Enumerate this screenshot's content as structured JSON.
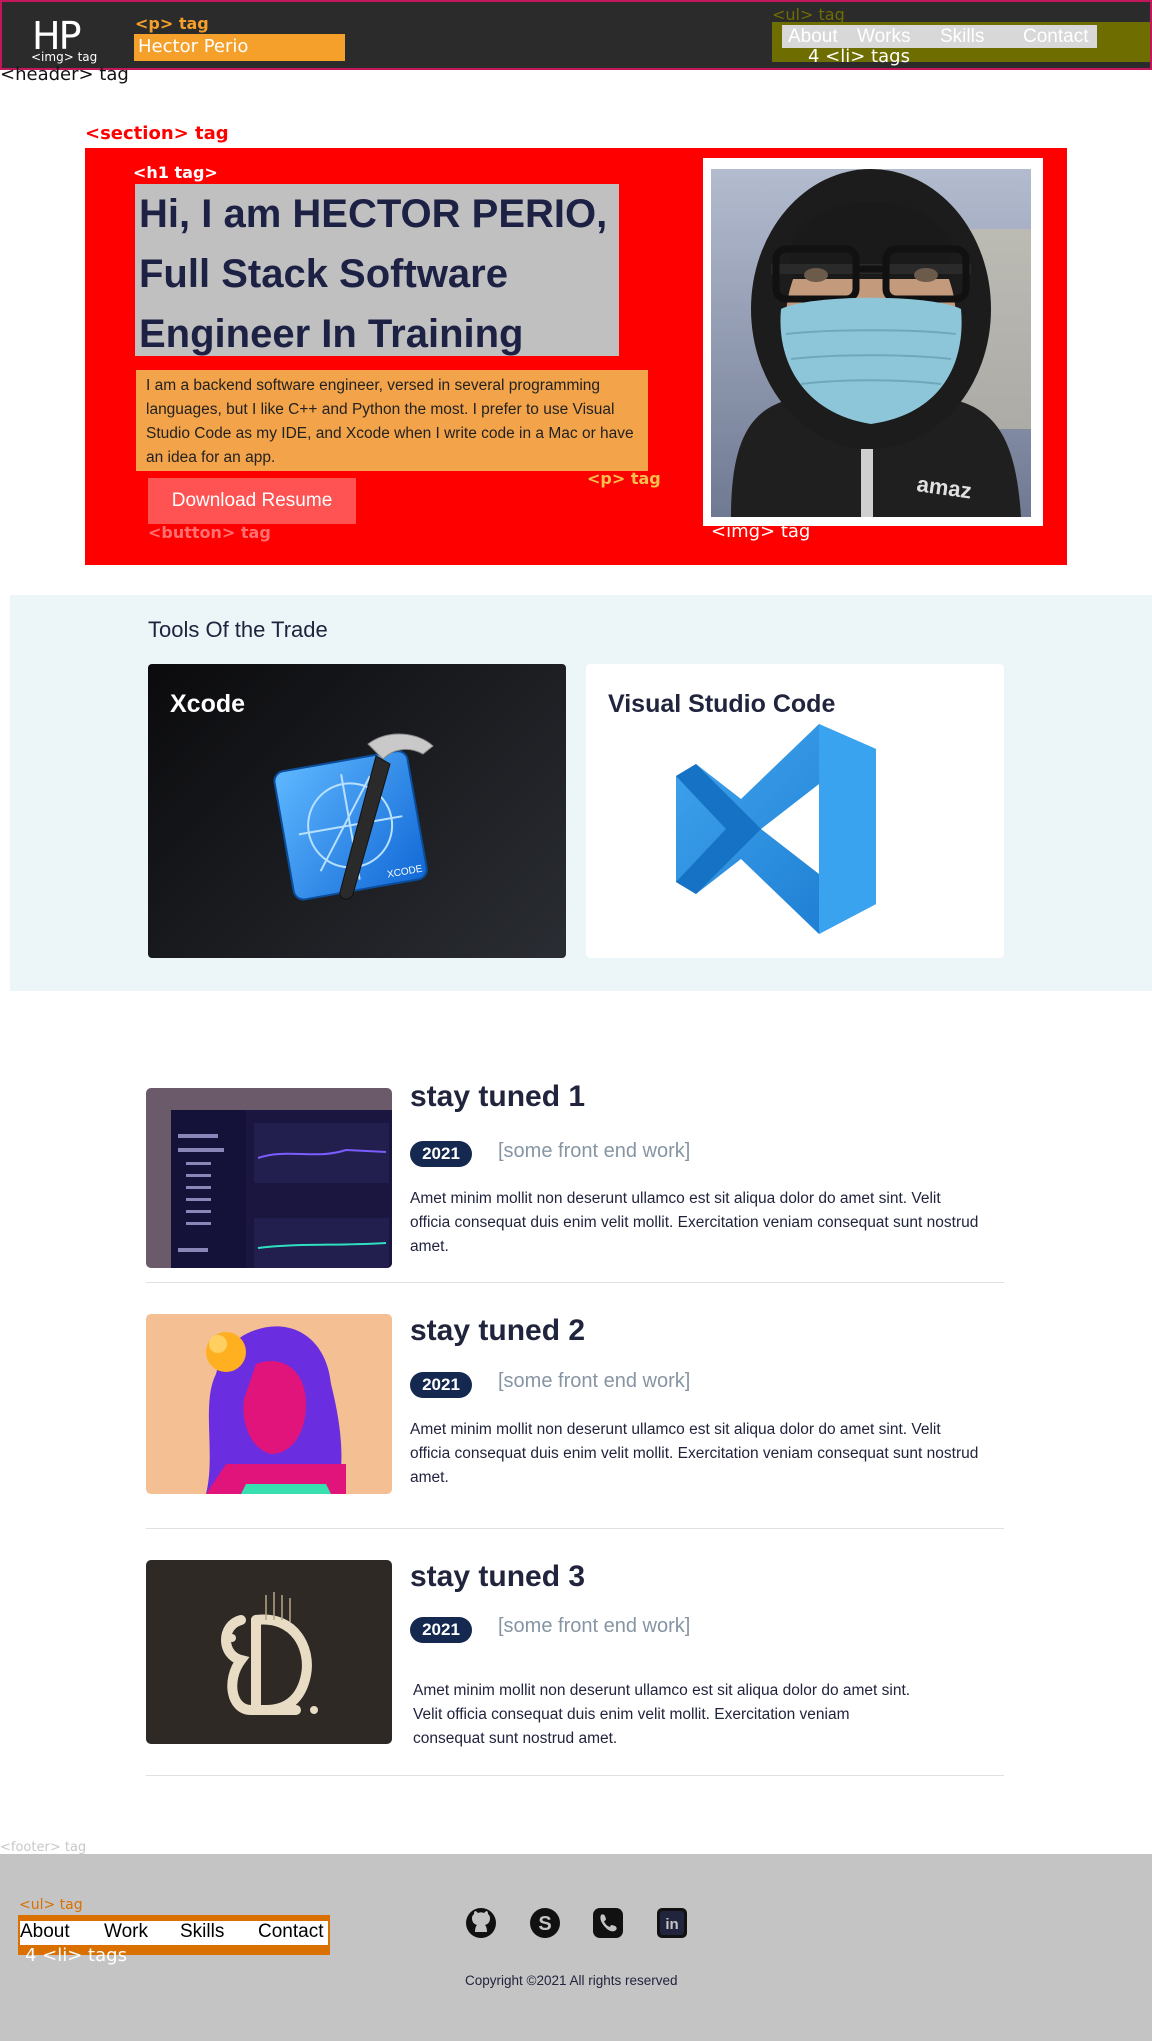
{
  "header": {
    "logo": "HP",
    "logo_tag": "<img> tag",
    "p_tag": "<p> tag",
    "brand": "Hector Perio",
    "ul_tag": "<ul> tag",
    "nav": [
      "About",
      "Works",
      "Skills",
      "Contact"
    ],
    "li_tags": "4 <li> tags",
    "header_tag": "<header> tag"
  },
  "hero": {
    "section_tag": "<section> tag",
    "h1_tag": "<h1 tag>",
    "h1_lines": [
      "Hi, I am HECTOR PERIO,",
      "Full Stack Software",
      "Engineer In Training"
    ],
    "intro": "I am a backend software engineer, versed in several programming languages, but I like C++ and Python the most. I prefer to use Visual Studio Code as my IDE, and Xcode when I write code in a Mac or have an idea for an app.",
    "p_tag": "<p> tag",
    "button": "Download Resume",
    "button_tag": "<button> tag",
    "img_tag": "<img> tag"
  },
  "tools": {
    "title": "Tools Of the Trade",
    "items": [
      {
        "name": "Xcode",
        "icon": "xcode-icon"
      },
      {
        "name": "Visual Studio Code",
        "icon": "vscode-icon"
      }
    ]
  },
  "works": [
    {
      "title": "stay tuned 1",
      "year": "2021",
      "category": "[some front end work]",
      "desc": "Amet minim mollit non deserunt ullamco est sit aliqua dolor do amet sint. Velit officia consequat duis enim velit mollit. Exercitation veniam consequat sunt nostrud amet."
    },
    {
      "title": "stay tuned 2",
      "year": "2021",
      "category": "[some front end work]",
      "desc": "Amet minim mollit non deserunt ullamco est sit aliqua dolor do amet sint. Velit officia consequat duis enim velit mollit. Exercitation veniam consequat sunt nostrud amet."
    },
    {
      "title": "stay tuned 3",
      "year": "2021",
      "category": "[some front end work]",
      "desc": "Amet minim mollit non deserunt ullamco est sit aliqua dolor do amet sint. Velit officia consequat duis enim velit mollit. Exercitation veniam consequat sunt nostrud amet."
    }
  ],
  "footer": {
    "footer_tag": "<footer> tag",
    "ul_tag": "<ul> tag",
    "nav": [
      "About",
      "Work",
      "Skills",
      "Contact"
    ],
    "li_tags": "4 <li> tags",
    "socials": [
      "github-icon",
      "skype-icon",
      "phone-icon",
      "linkedin-icon"
    ],
    "copyright": "Copyright ©2021 All rights reserved"
  },
  "colors": {
    "header_bg": "#2b2b2b",
    "brand_bg": "#f5a02a",
    "hero_bg": "#ff0000",
    "accent_button": "#ff5252",
    "navy": "#21243d",
    "tools_bg": "#ecf5f8",
    "footer_bg": "#c4c4c4"
  }
}
